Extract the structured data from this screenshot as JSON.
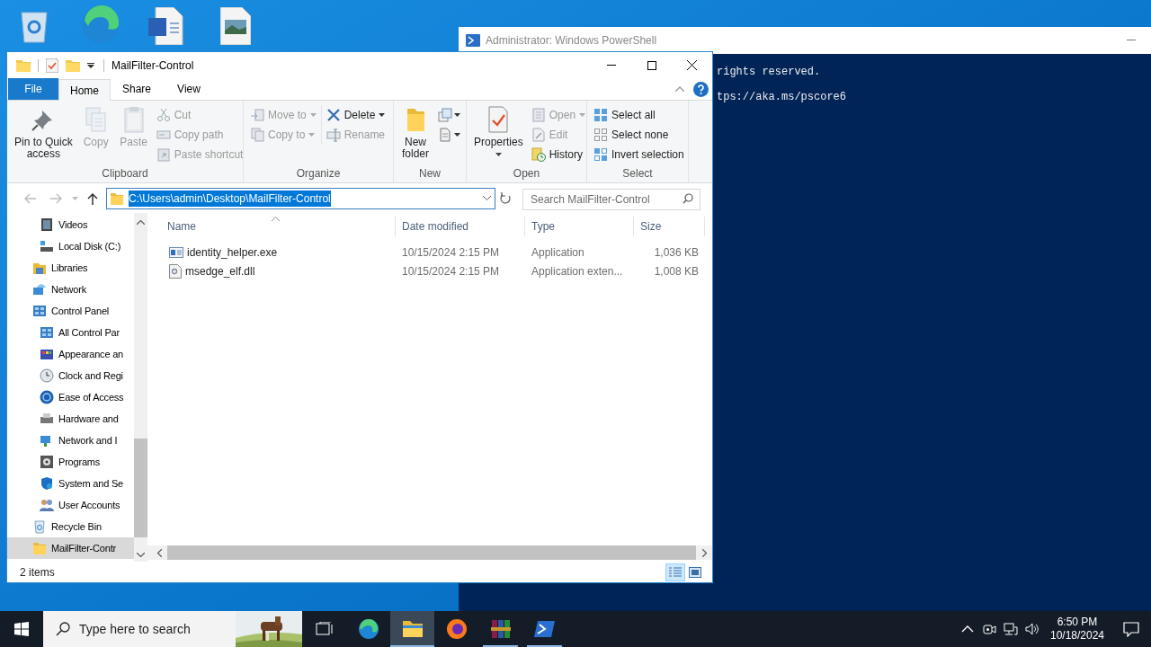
{
  "powershell": {
    "title": "Administrator: Windows PowerShell",
    "lines": [
      "rights reserved.",
      "tps://aka.ms/pscore6"
    ]
  },
  "explorer": {
    "title": "MailFilter-Control",
    "ribbon_tabs": [
      {
        "label": "File",
        "kind": "menu",
        "selected": false
      },
      {
        "label": "Home",
        "kind": "tab",
        "selected": true
      },
      {
        "label": "Share",
        "kind": "tab",
        "selected": false
      },
      {
        "label": "View",
        "kind": "tab",
        "selected": false
      }
    ],
    "ribbon_groups": [
      {
        "label": "Clipboard",
        "columns": [
          [
            {
              "label": "Pin to Quick\naccess",
              "kind": "large",
              "disabled": false,
              "dropdown": false
            }
          ],
          [
            {
              "label": "Copy",
              "kind": "large",
              "disabled": true,
              "dropdown": false
            }
          ],
          [
            {
              "label": "Paste",
              "kind": "large",
              "disabled": true,
              "dropdown": false
            }
          ],
          [
            {
              "label": "Cut",
              "kind": "small",
              "disabled": true,
              "dropdown": false
            },
            {
              "label": "Copy path",
              "kind": "small",
              "disabled": true,
              "dropdown": false
            },
            {
              "label": "Paste shortcut",
              "kind": "small",
              "disabled": true,
              "dropdown": false
            }
          ]
        ]
      },
      {
        "label": "Organize",
        "columns": [
          [
            {
              "label": "Move to",
              "kind": "small",
              "disabled": true,
              "dropdown": true
            },
            {
              "label": "Copy to",
              "kind": "small",
              "disabled": true,
              "dropdown": true
            }
          ],
          [
            {
              "label": "Delete",
              "kind": "small",
              "disabled": false,
              "dropdown": true
            },
            {
              "label": "Rename",
              "kind": "small",
              "disabled": true,
              "dropdown": false
            }
          ]
        ]
      },
      {
        "label": "New",
        "columns": [
          [
            {
              "label": "New\nfolder",
              "kind": "large",
              "disabled": false,
              "dropdown": false
            }
          ],
          [
            {
              "kind": "icon",
              "disabled": false,
              "dropdown": true
            },
            {
              "kind": "icon",
              "disabled": false,
              "dropdown": true
            }
          ]
        ]
      },
      {
        "label": "Open",
        "columns": [
          [
            {
              "label": "Properties",
              "kind": "large",
              "disabled": false,
              "dropdown": true
            }
          ],
          [
            {
              "label": "Open",
              "kind": "small",
              "disabled": true,
              "dropdown": true
            },
            {
              "label": "Edit",
              "kind": "small",
              "disabled": true,
              "dropdown": false
            },
            {
              "label": "History",
              "kind": "small",
              "disabled": false,
              "dropdown": false
            }
          ]
        ]
      },
      {
        "label": "Select",
        "columns": [
          [
            {
              "label": "Select all",
              "kind": "small",
              "disabled": false,
              "dropdown": false
            },
            {
              "label": "Select none",
              "kind": "small",
              "disabled": false,
              "dropdown": false
            },
            {
              "label": "Invert selection",
              "kind": "small",
              "disabled": false,
              "dropdown": false
            }
          ]
        ]
      }
    ],
    "address": {
      "path": "C:\\Users\\admin\\Desktop\\MailFilter-Control",
      "text_selected": true
    },
    "search": {
      "placeholder": "Search MailFilter-Control"
    },
    "nav_items": [
      {
        "children": [
          {
            "label": "Videos",
            "selected": false
          },
          {
            "label": "Local Disk (C:)",
            "selected": false
          }
        ]
      },
      {
        "label": "Libraries",
        "selected": false
      },
      {
        "label": "Network",
        "selected": false
      },
      {
        "label": "Control Panel",
        "selected": false,
        "children": [
          {
            "label": "All Control Par",
            "selected": false
          },
          {
            "label": "Appearance an",
            "selected": false
          },
          {
            "label": "Clock and Regi",
            "selected": false
          },
          {
            "label": "Ease of Access",
            "selected": false
          },
          {
            "label": "Hardware and",
            "selected": false
          },
          {
            "label": "Network and I",
            "selected": false
          },
          {
            "label": "Programs",
            "selected": false
          },
          {
            "label": "System and Se",
            "selected": false
          },
          {
            "label": "User Accounts",
            "selected": false
          }
        ]
      },
      {
        "label": "Recycle Bin",
        "selected": false
      },
      {
        "label": "MailFilter-Contr",
        "selected": true
      }
    ],
    "columns": [
      {
        "label": "Name",
        "sorted": true
      },
      {
        "label": "Date modified",
        "sorted": false
      },
      {
        "label": "Type",
        "sorted": false
      },
      {
        "label": "Size",
        "sorted": false
      }
    ],
    "files": [
      {
        "kind": "exe",
        "name": "identity_helper.exe",
        "date": "10/15/2024 2:15 PM",
        "type": "Application",
        "size": "1,036 KB"
      },
      {
        "kind": "dll",
        "name": "msedge_elf.dll",
        "date": "10/15/2024 2:15 PM",
        "type": "Application exten...",
        "size": "1,008 KB"
      }
    ],
    "status": "2 items",
    "views": [
      {
        "kind": "details",
        "selected": true
      },
      {
        "kind": "large_icons",
        "selected": false
      }
    ]
  },
  "taskbar": {
    "search_placeholder": "Type here to search",
    "apps": [
      {
        "kind": "task_view",
        "open": false,
        "selected": false
      },
      {
        "kind": "edge",
        "open": false,
        "selected": false
      },
      {
        "kind": "explorer",
        "open": true,
        "selected": true
      },
      {
        "kind": "firefox",
        "open": false,
        "selected": false
      },
      {
        "kind": "winrar",
        "open": true,
        "selected": false
      },
      {
        "kind": "powershell",
        "open": true,
        "selected": false
      }
    ],
    "time": "6:50 PM",
    "date": "10/18/2024"
  }
}
